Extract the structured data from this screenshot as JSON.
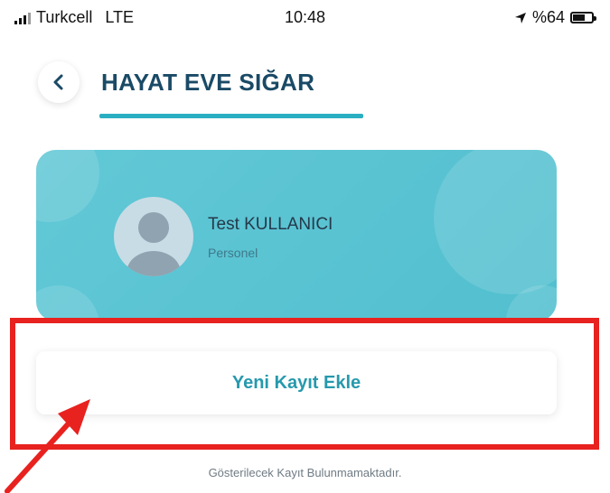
{
  "status_bar": {
    "carrier": "Turkcell",
    "network": "LTE",
    "time": "10:48",
    "battery_percent": "%64",
    "battery_level": 0.64
  },
  "header": {
    "title": "HAYAT EVE SIĞAR"
  },
  "profile": {
    "name": "Test KULLANICI",
    "role": "Personel"
  },
  "actions": {
    "add_record_label": "Yeni Kayıt Ekle"
  },
  "empty_state": {
    "message": "Gösterilecek Kayıt Bulunmamaktadır."
  },
  "colors": {
    "accent": "#2aaec2",
    "title": "#1a4a66",
    "card": "#5cc4d3",
    "highlight": "#e8221f"
  }
}
